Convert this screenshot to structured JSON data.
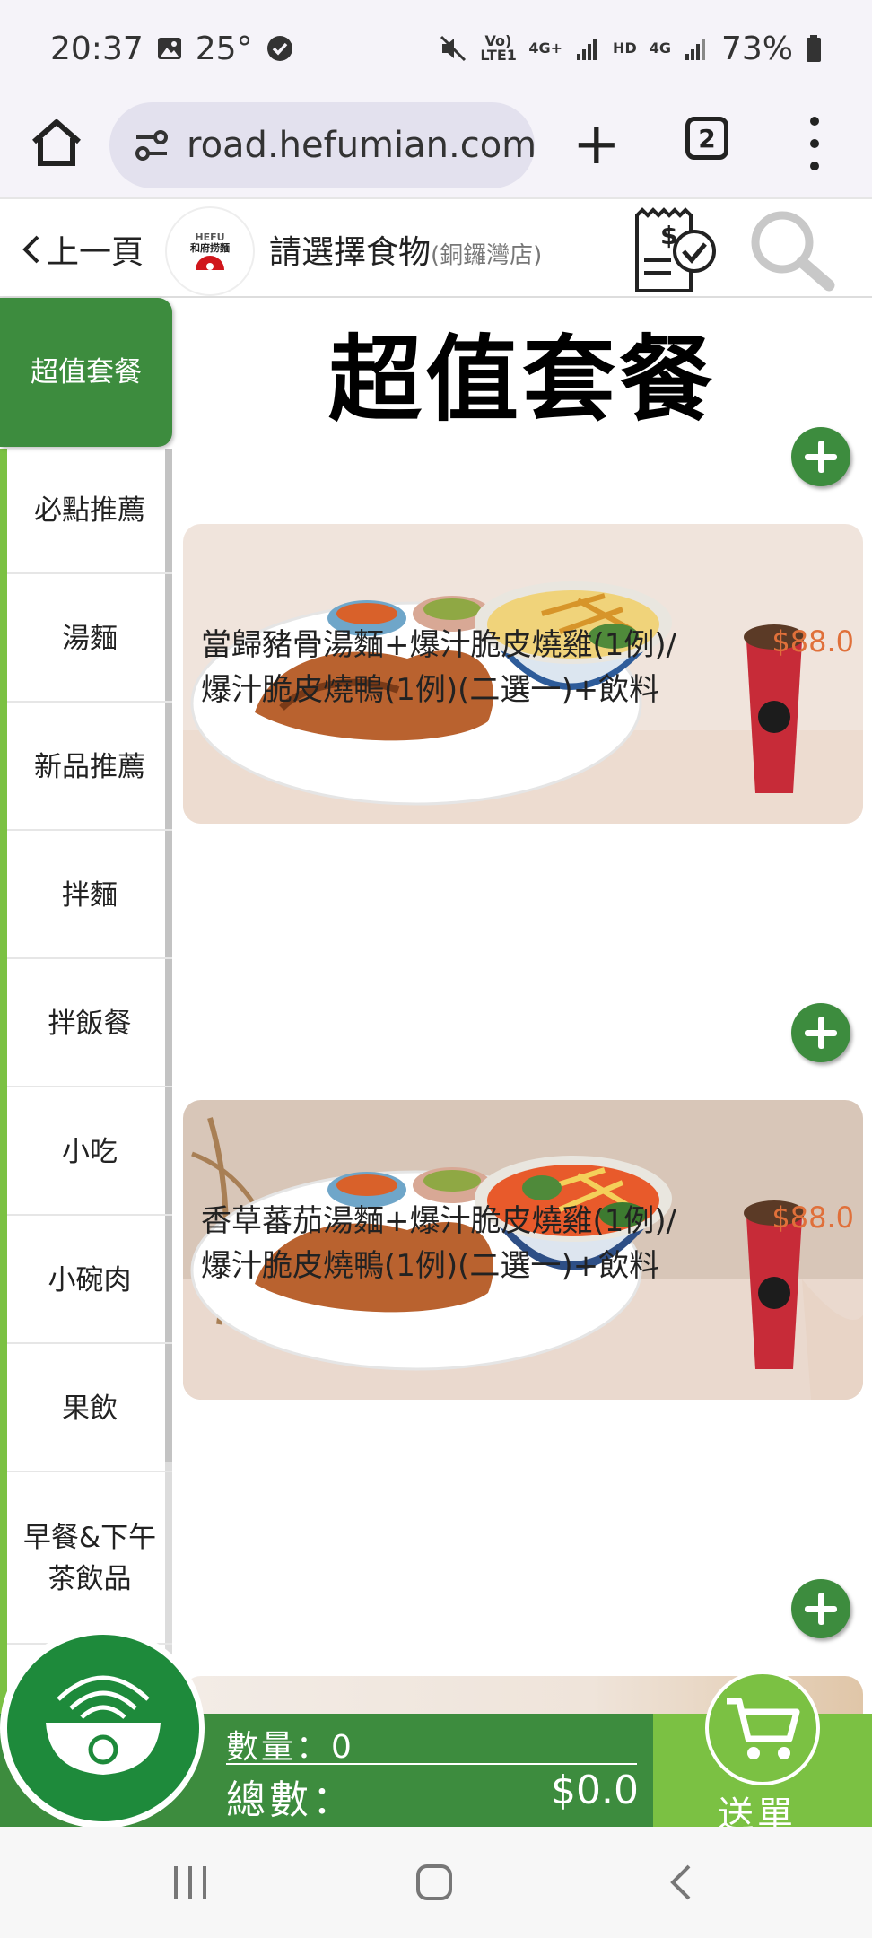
{
  "status_bar": {
    "time": "20:37",
    "temperature": "25°",
    "volte_label": "Vo) LTE1",
    "net_4g_plus": "4G+",
    "hd_label": "HD",
    "net_4g": "4G",
    "battery": "73%"
  },
  "browser": {
    "url": "road.hefumian.com",
    "new_tab_label": "+",
    "tab_count": "2"
  },
  "header": {
    "back_label": "上一頁",
    "logo_text_top": "HEFU",
    "logo_text_bottom": "和府捞麵",
    "title": "請選擇食物",
    "store": "(銅鑼灣店)"
  },
  "sidebar": {
    "items": [
      {
        "label": "超值套餐",
        "active": true
      },
      {
        "label": "必點推薦",
        "active": false
      },
      {
        "label": "湯麵",
        "active": false
      },
      {
        "label": "新品推薦",
        "active": false
      },
      {
        "label": "拌麵",
        "active": false
      },
      {
        "label": "拌飯餐",
        "active": false
      },
      {
        "label": "小吃",
        "active": false
      },
      {
        "label": "小碗肉",
        "active": false
      },
      {
        "label": "果飲",
        "active": false
      },
      {
        "label": "早餐&下午茶飲品",
        "active": false
      }
    ]
  },
  "section": {
    "title": "超值套餐"
  },
  "items": [
    {
      "name": "當歸豬骨湯麵+爆汁脆皮燒雞(1例)/爆汁脆皮燒鴨(1例)(二選一)+飲料",
      "price": "$88.0",
      "soup_color": "#f0d37a"
    },
    {
      "name": "香草蕃茄湯麵+爆汁脆皮燒雞(1例)/爆汁脆皮燒鴨(1例)(二選一)+飲料",
      "price": "$88.0",
      "soup_color": "#e85a2b"
    }
  ],
  "cart": {
    "quantity_label": "數量：0",
    "total_label": "總數：",
    "total_amount": "$0.0",
    "submit_label": "送單"
  },
  "colors": {
    "brand_green": "#3d8c3e",
    "light_green": "#7bc143",
    "price_orange": "#e0703a"
  }
}
